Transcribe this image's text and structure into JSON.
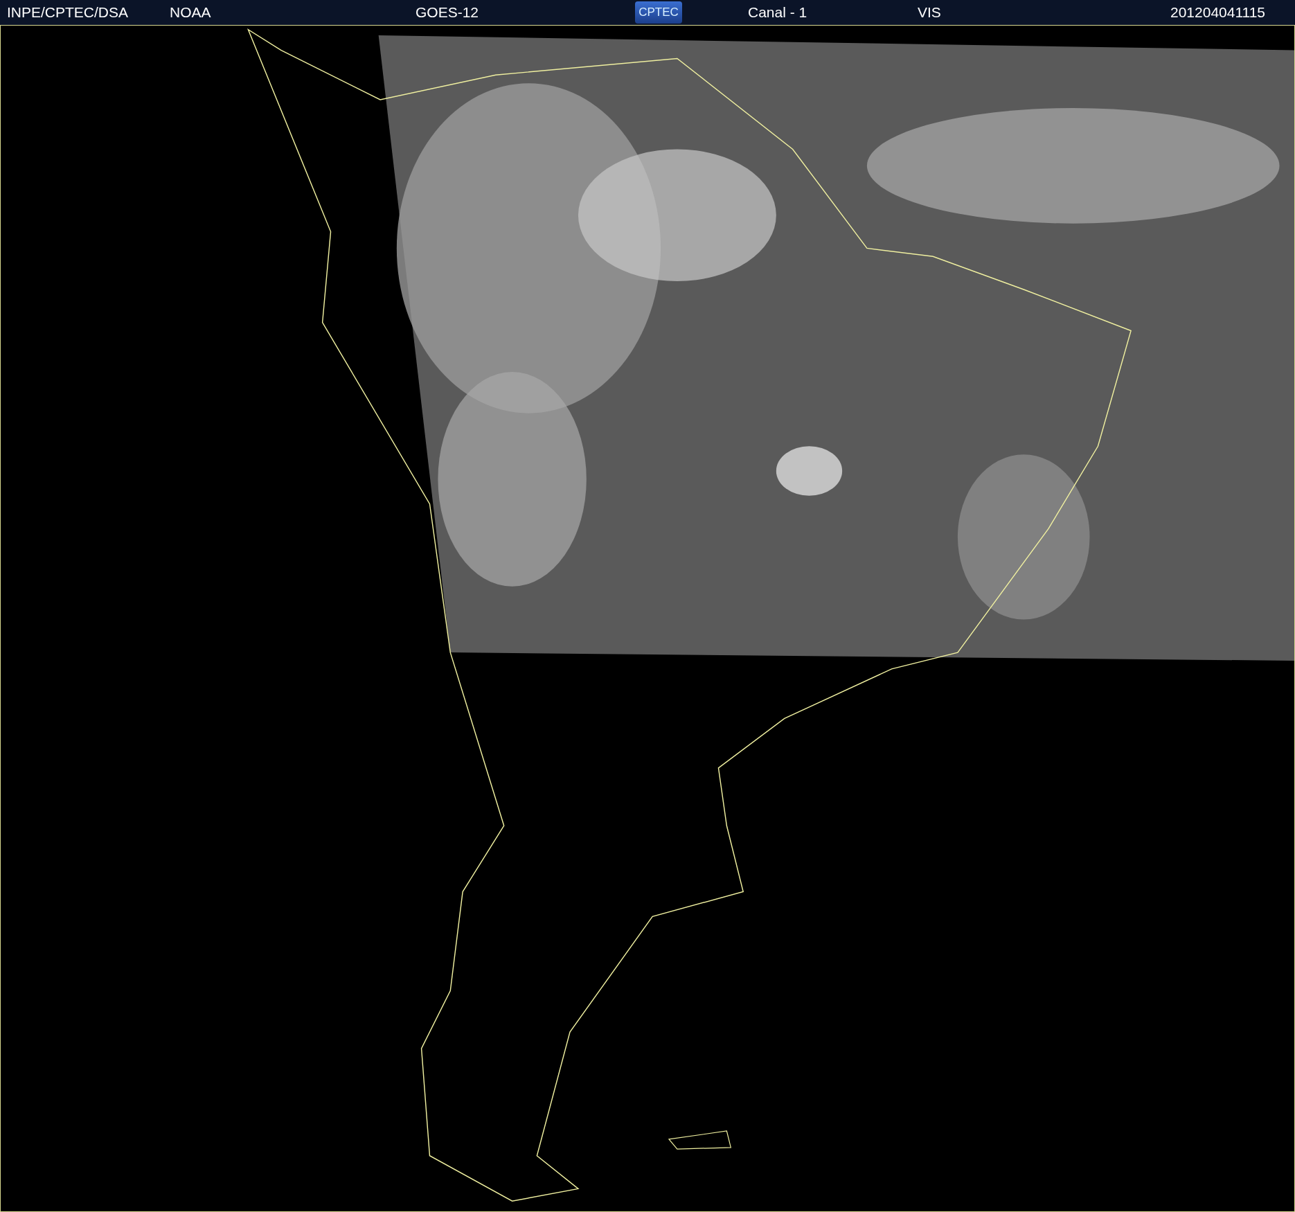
{
  "header": {
    "source": "INPE/CPTEC/DSA",
    "agency": "NOAA",
    "satellite": "GOES-12",
    "logo": "CPTEC",
    "channel": "Canal - 1",
    "band": "VIS",
    "timestamp": "201204041115"
  }
}
